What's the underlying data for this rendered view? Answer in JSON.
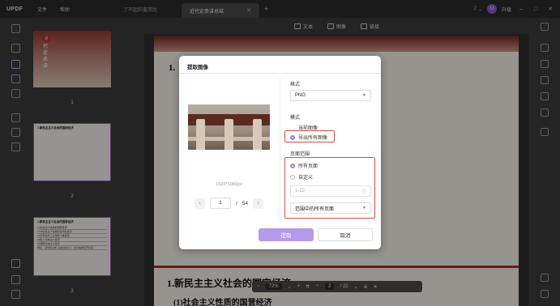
{
  "app": {
    "logo": "UPDF"
  },
  "menu": {
    "file": "文件",
    "help": "帮助"
  },
  "tabs": [
    {
      "label": "了不起的盖茨比"
    },
    {
      "label": "近代史串讲总结"
    }
  ],
  "titlebar": {
    "badge_count": "2",
    "avatar_letter": "U",
    "upgrade_label": "升级"
  },
  "toolbar": {
    "text_label": "文本",
    "image_label": "图像",
    "link_label": "链接"
  },
  "thumbnails": {
    "page1_seal": "近",
    "page1_title": "代史串讲",
    "page_numbers": [
      "1",
      "2",
      "3"
    ],
    "page2_heading": "1.新民主主义社会的国家经济",
    "page3_heading": "1.新民主主义社会的国家经济",
    "page3_lines": [
      "(1)社会主义性质的国营经济",
      "(2)半社会主义性质的合作社经济",
      "(3)农民和手工业者的个体经济",
      "(4)私人资本主义经济",
      "(5)国家资本主义经济",
      "特点：领导和主体上是社会主义，允许各种经济共存"
    ]
  },
  "document": {
    "page1_heading": "1.",
    "page2_heading": "1.新民主主义社会的国家经济",
    "page2_sub": "(1)社会主义性质的国营经济"
  },
  "zoom": {
    "level": "72%",
    "page_current": "2",
    "page_total": "/ 22"
  },
  "dialog": {
    "title": "提取图像",
    "image_size": "1920*1080px",
    "page_current": "1",
    "page_sep": "/",
    "page_total": "54",
    "format_label": "格式",
    "format_value": "PNG",
    "mode_label": "模式",
    "mode_current": "当前图像",
    "mode_export_all": "导出所有图像",
    "range_label": "页面范围",
    "range_all": "所有页面",
    "range_custom": "自定义",
    "range_placeholder": "1-22",
    "range_select": "范围中的所有页面",
    "ok_label": "提取",
    "cancel_label": "取消"
  }
}
